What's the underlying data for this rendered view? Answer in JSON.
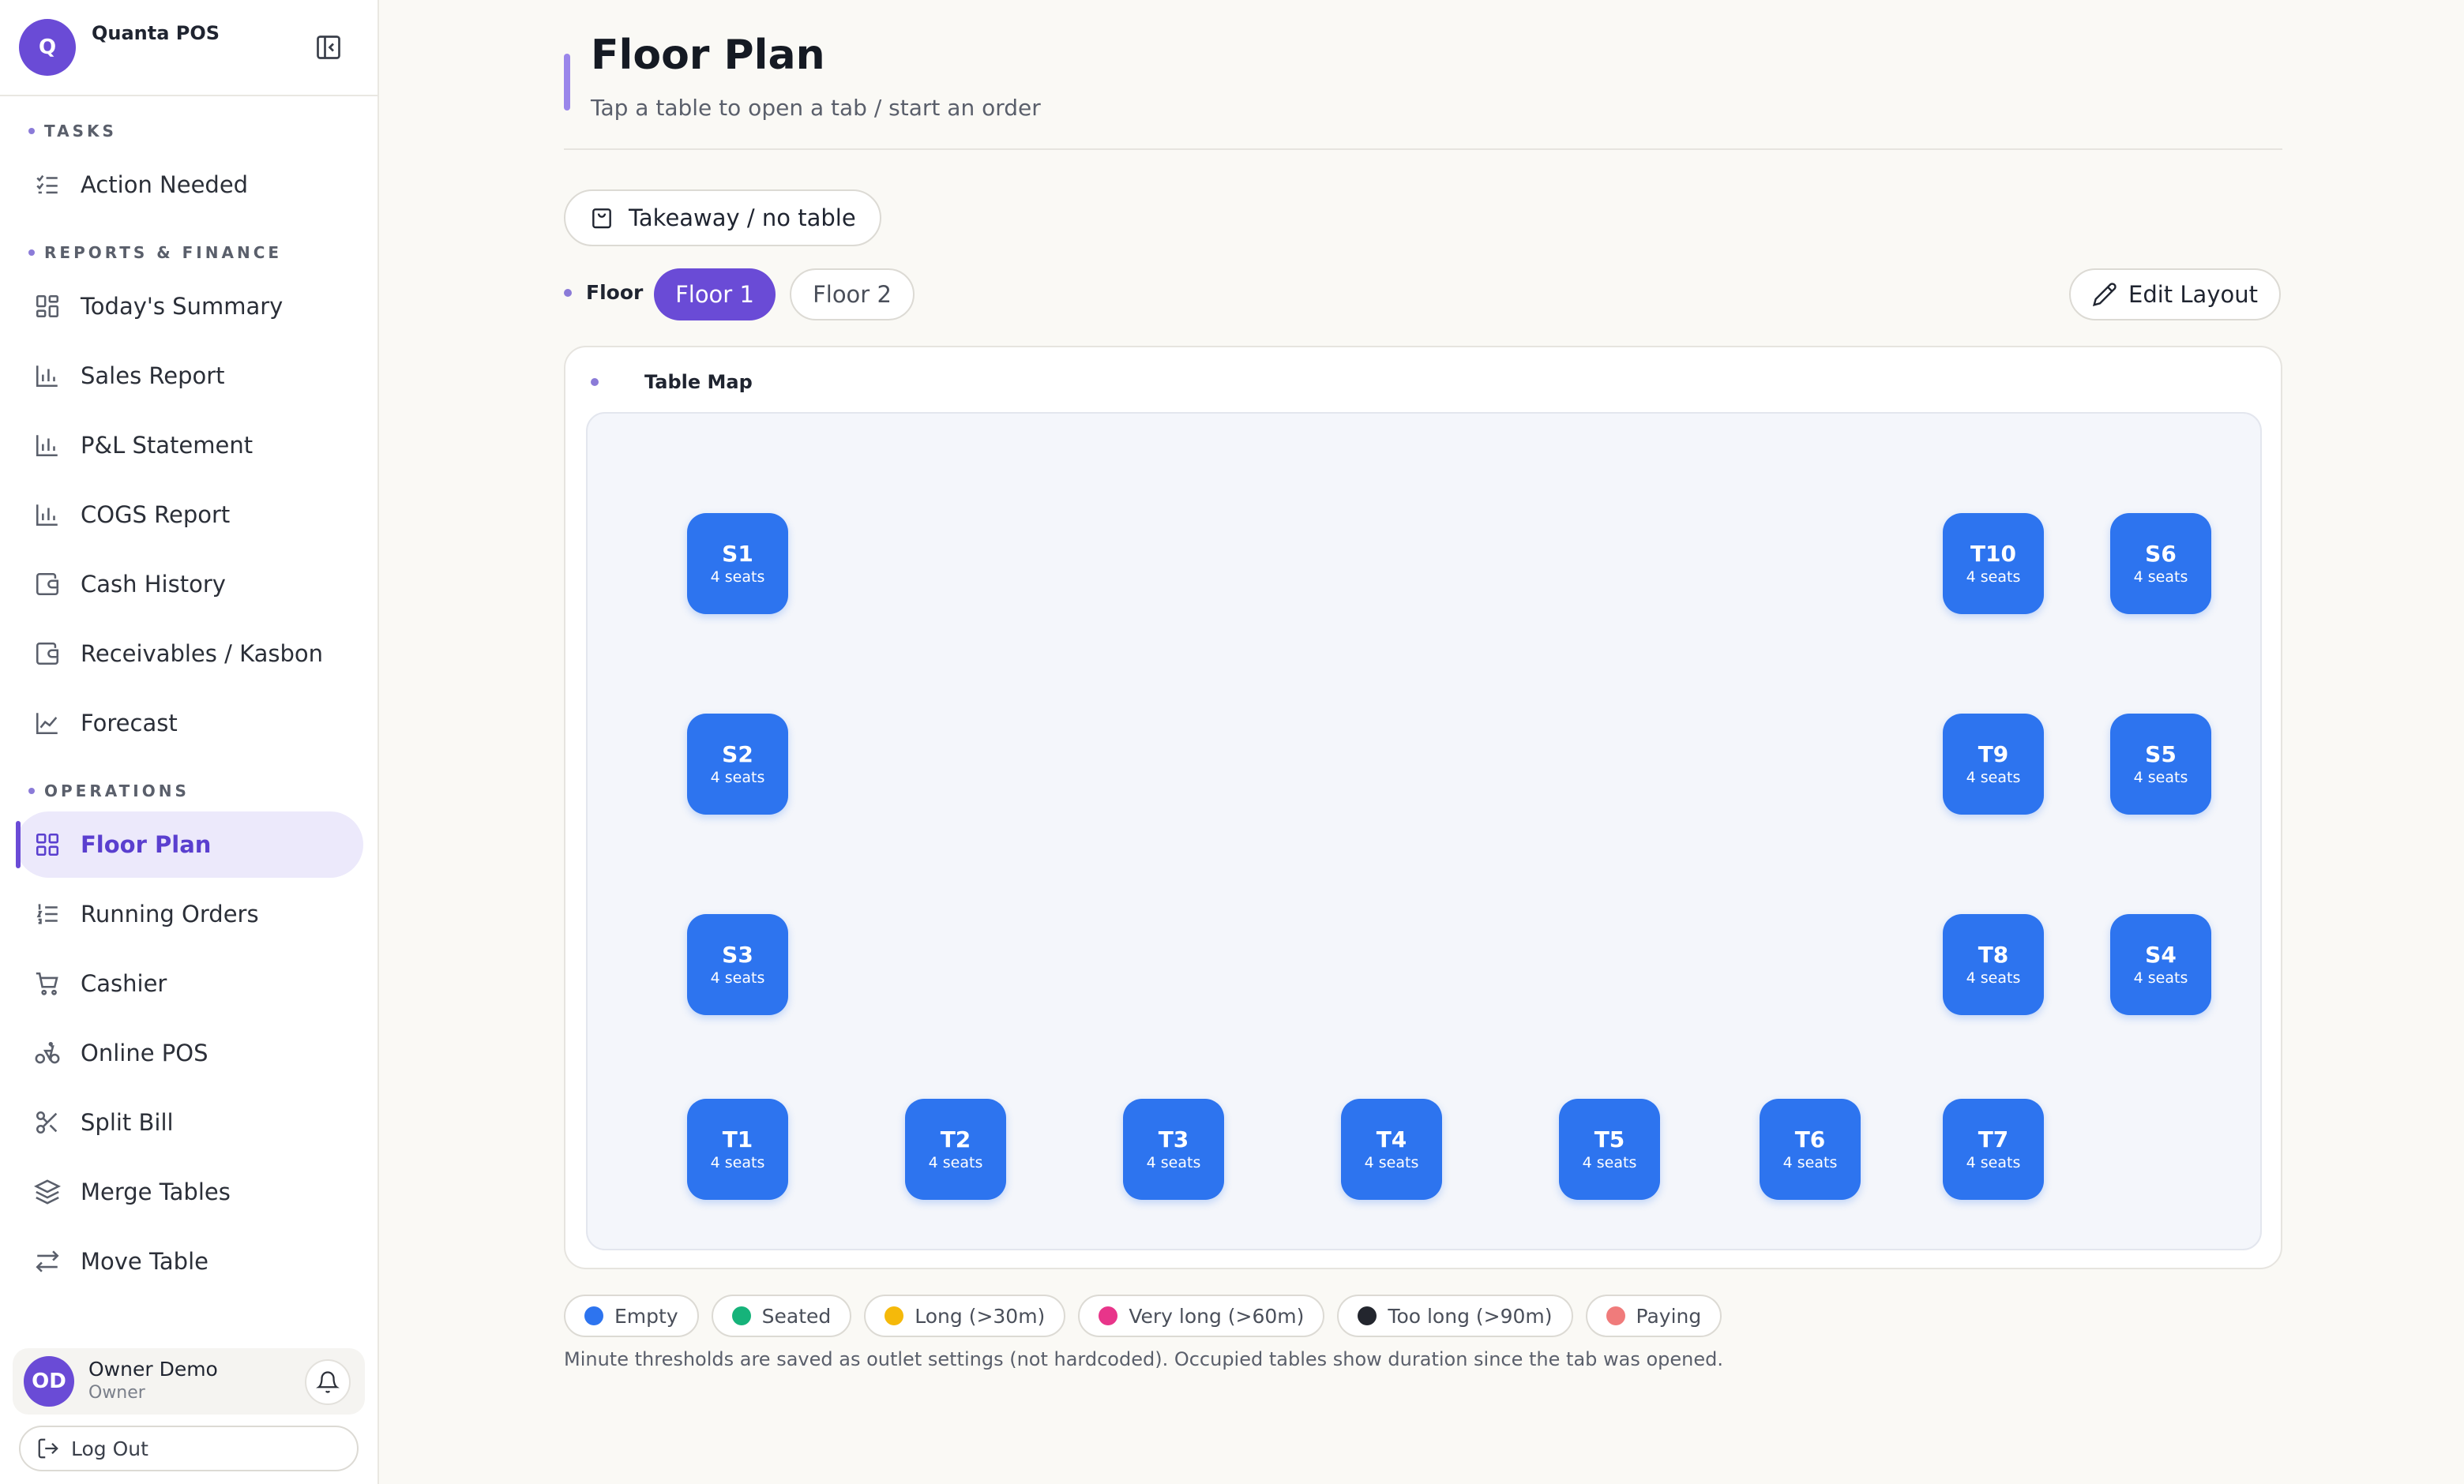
{
  "brand": {
    "initial": "Q",
    "name": "Quanta POS"
  },
  "sidebar": {
    "sections": [
      {
        "label": "TASKS"
      },
      {
        "label": "REPORTS & FINANCE"
      },
      {
        "label": "OPERATIONS"
      }
    ],
    "items": [
      {
        "label": "Action Needed",
        "icon": "checklist-icon"
      },
      {
        "label": "Today's Summary",
        "icon": "dashboard-icon"
      },
      {
        "label": "Sales Report",
        "icon": "bar-chart-icon"
      },
      {
        "label": "P&L Statement",
        "icon": "bar-chart-icon"
      },
      {
        "label": "COGS Report",
        "icon": "bar-chart-icon"
      },
      {
        "label": "Cash History",
        "icon": "wallet-icon"
      },
      {
        "label": "Receivables / Kasbon",
        "icon": "wallet-icon"
      },
      {
        "label": "Forecast",
        "icon": "line-chart-icon"
      },
      {
        "label": "Floor Plan",
        "icon": "grid-icon",
        "active": true
      },
      {
        "label": "Running Orders",
        "icon": "ordered-list-icon"
      },
      {
        "label": "Cashier",
        "icon": "cart-icon"
      },
      {
        "label": "Online POS",
        "icon": "bike-icon"
      },
      {
        "label": "Split Bill",
        "icon": "scissors-icon"
      },
      {
        "label": "Merge Tables",
        "icon": "layers-icon"
      },
      {
        "label": "Move Table",
        "icon": "swap-icon"
      }
    ]
  },
  "user": {
    "initials": "OD",
    "name": "Owner Demo",
    "role": "Owner",
    "logout_label": "Log Out"
  },
  "page": {
    "title": "Floor Plan",
    "subtitle": "Tap a table to open a tab / start an order",
    "takeaway_label": "Takeaway / no table",
    "floor_label": "Floor",
    "floors": [
      "Floor 1",
      "Floor 2"
    ],
    "active_floor": "Floor 1",
    "edit_layout_label": "Edit Layout",
    "map_title": "Table Map"
  },
  "tables": [
    {
      "name": "S1",
      "seats": "4 seats",
      "status": "empty"
    },
    {
      "name": "S2",
      "seats": "4 seats",
      "status": "empty"
    },
    {
      "name": "S3",
      "seats": "4 seats",
      "status": "empty"
    },
    {
      "name": "T10",
      "seats": "4 seats",
      "status": "empty"
    },
    {
      "name": "T9",
      "seats": "4 seats",
      "status": "empty"
    },
    {
      "name": "T8",
      "seats": "4 seats",
      "status": "empty"
    },
    {
      "name": "S6",
      "seats": "4 seats",
      "status": "empty"
    },
    {
      "name": "S5",
      "seats": "4 seats",
      "status": "empty"
    },
    {
      "name": "S4",
      "seats": "4 seats",
      "status": "empty"
    },
    {
      "name": "T1",
      "seats": "4 seats",
      "status": "empty"
    },
    {
      "name": "T2",
      "seats": "4 seats",
      "status": "empty"
    },
    {
      "name": "T3",
      "seats": "4 seats",
      "status": "empty"
    },
    {
      "name": "T4",
      "seats": "4 seats",
      "status": "empty"
    },
    {
      "name": "T5",
      "seats": "4 seats",
      "status": "empty"
    },
    {
      "name": "T6",
      "seats": "4 seats",
      "status": "empty"
    },
    {
      "name": "T7",
      "seats": "4 seats",
      "status": "empty"
    }
  ],
  "legend": [
    {
      "label": "Empty",
      "color": "#2d74ef"
    },
    {
      "label": "Seated",
      "color": "#16b37a"
    },
    {
      "label": "Long (>30m)",
      "color": "#f5b90a"
    },
    {
      "label": "Very long (>60m)",
      "color": "#e8358a"
    },
    {
      "label": "Too long (>90m)",
      "color": "#23262e"
    },
    {
      "label": "Paying",
      "color": "#f07b7b"
    }
  ],
  "note": "Minute thresholds are saved as outlet settings (not hardcoded). Occupied tables show duration since the tab was opened.",
  "colors": {
    "accent": "#6a4bd6",
    "table_empty": "#2d74ef"
  }
}
